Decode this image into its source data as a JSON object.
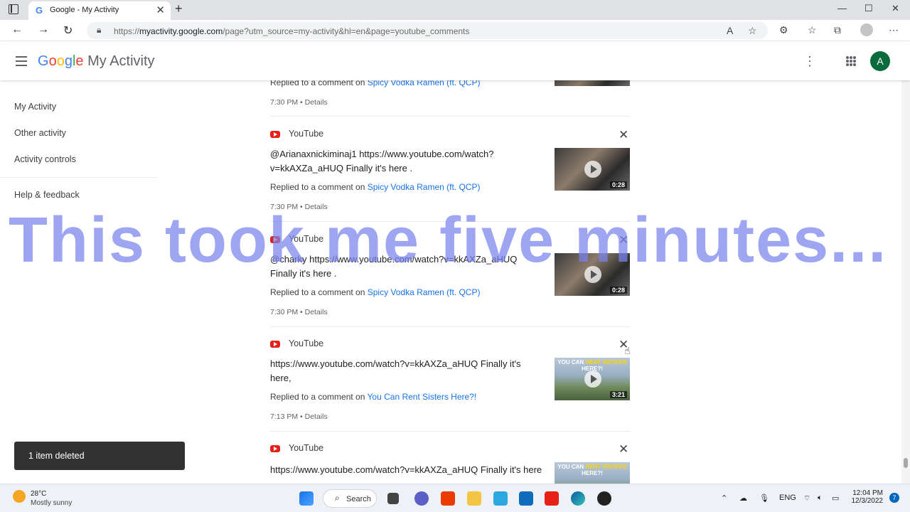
{
  "browser": {
    "tab_title": "Google - My Activity",
    "tab_close": "✕",
    "new_tab": "+",
    "url_prefix": "https://",
    "url_host": "myactivity.google.com",
    "url_path": "/page?utm_source=my-activity&hl=en&page=youtube_comments",
    "window_min": "—",
    "window_max": "☐",
    "window_close": "✕"
  },
  "header": {
    "logo_letters": [
      "G",
      "o",
      "o",
      "g",
      "l",
      "e"
    ],
    "product": "My Activity",
    "avatar_letter": "A"
  },
  "sidebar": {
    "items": [
      {
        "label": "My Activity"
      },
      {
        "label": "Other activity"
      },
      {
        "label": "Activity controls"
      }
    ],
    "help": "Help & feedback"
  },
  "feed": {
    "top_partial": {
      "replied_prefix": "Replied to a comment on",
      "video": "Spicy Vodka Ramen (ft. QCP)",
      "meta": "7:30 PM • Details"
    },
    "entries": [
      {
        "source": "YouTube",
        "comment": " @Arianaxnickiminaj1  https://www.youtube.com/watch?v=kkAXZa_aHUQ Finally it's here .",
        "replied_prefix": "Replied to a comment on",
        "video": "Spicy Vodka Ramen (ft. QCP)",
        "meta": "7:30 PM • Details",
        "duration": "0:28"
      },
      {
        "source": "YouTube",
        "comment": " @charky  https://www.youtube.com/watch?v=kkAXZa_aHUQ Finally it's here .",
        "replied_prefix": "Replied to a comment on",
        "video": "Spicy Vodka Ramen (ft. QCP)",
        "meta": "7:30 PM • Details",
        "duration": "0:28"
      },
      {
        "source": "YouTube",
        "comment": "https://www.youtube.com/watch?v=kkAXZa_aHUQ Finally it's here,",
        "replied_prefix": "Replied to a comment on",
        "video": "You Can Rent Sisters Here?!",
        "meta": "7:13 PM • Details",
        "duration": "3:21",
        "thumb_banner_a": "YOU CAN ",
        "thumb_banner_b": "RENT SISTERS",
        "thumb_banner_c": " HERE?!"
      },
      {
        "source": "YouTube",
        "comment": "https://www.youtube.com/watch?v=kkAXZa_aHUQ Finally it's here",
        "thumb_banner_a": "YOU CAN ",
        "thumb_banner_b": "RENT SISTERS",
        "thumb_banner_c": " HERE?!"
      }
    ]
  },
  "overlay_caption": "This took me five minutes...",
  "toast": "1 item deleted",
  "taskbar": {
    "temperature": "28°C",
    "weather": "Mostly sunny",
    "search_label": "Search",
    "language": "ENG",
    "time": "12:04 PM",
    "date": "12/3/2022",
    "notifications": "7"
  },
  "colors": {
    "youtube_red": "#e62117",
    "link_blue": "#1a73e8",
    "avatar_green": "#0b6b3a",
    "overlay": "#7882eb"
  }
}
